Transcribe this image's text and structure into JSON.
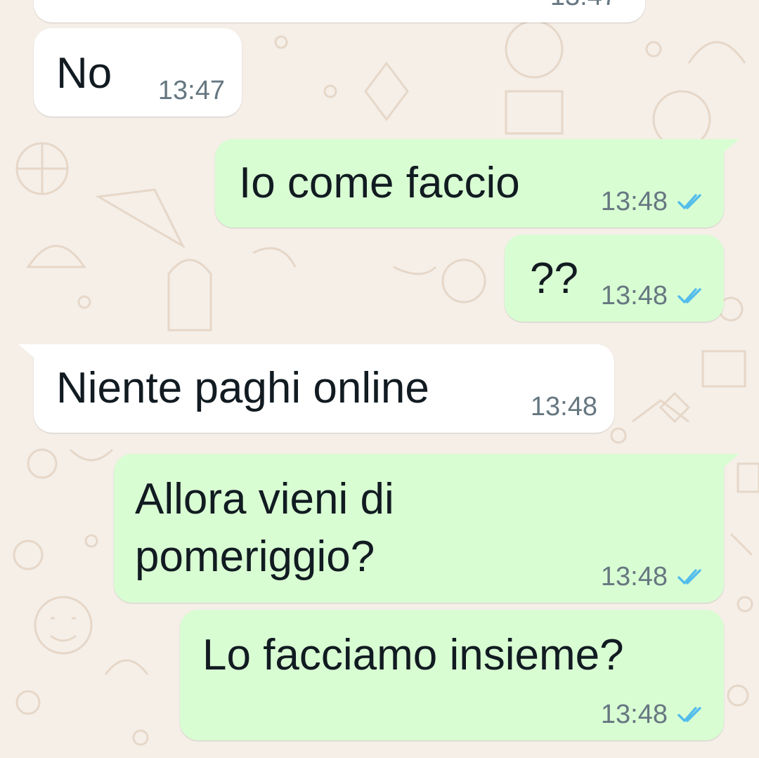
{
  "colors": {
    "background": "#f5efe8",
    "incoming_bubble": "#ffffff",
    "outgoing_bubble": "#d9fdd3",
    "message_text": "#111b21",
    "timestamp": "#667781",
    "read_ticks": "#53bdeb"
  },
  "icons": {
    "read_receipt": "double-check-icon"
  },
  "messages": [
    {
      "direction": "in",
      "text": "",
      "time": "13:47"
    },
    {
      "direction": "in",
      "text": "No",
      "time": "13:47"
    },
    {
      "direction": "out",
      "text": "Io come faccio",
      "time": "13:48",
      "status": "read"
    },
    {
      "direction": "out",
      "text": "??",
      "time": "13:48",
      "status": "read"
    },
    {
      "direction": "in",
      "text": "Niente paghi online",
      "time": "13:48"
    },
    {
      "direction": "out",
      "text": "Allora vieni di",
      "text_line2": "pomeriggio?",
      "time": "13:48",
      "status": "read"
    },
    {
      "direction": "out",
      "text": "Lo facciamo insieme?",
      "time": "13:48",
      "status": "read"
    }
  ]
}
